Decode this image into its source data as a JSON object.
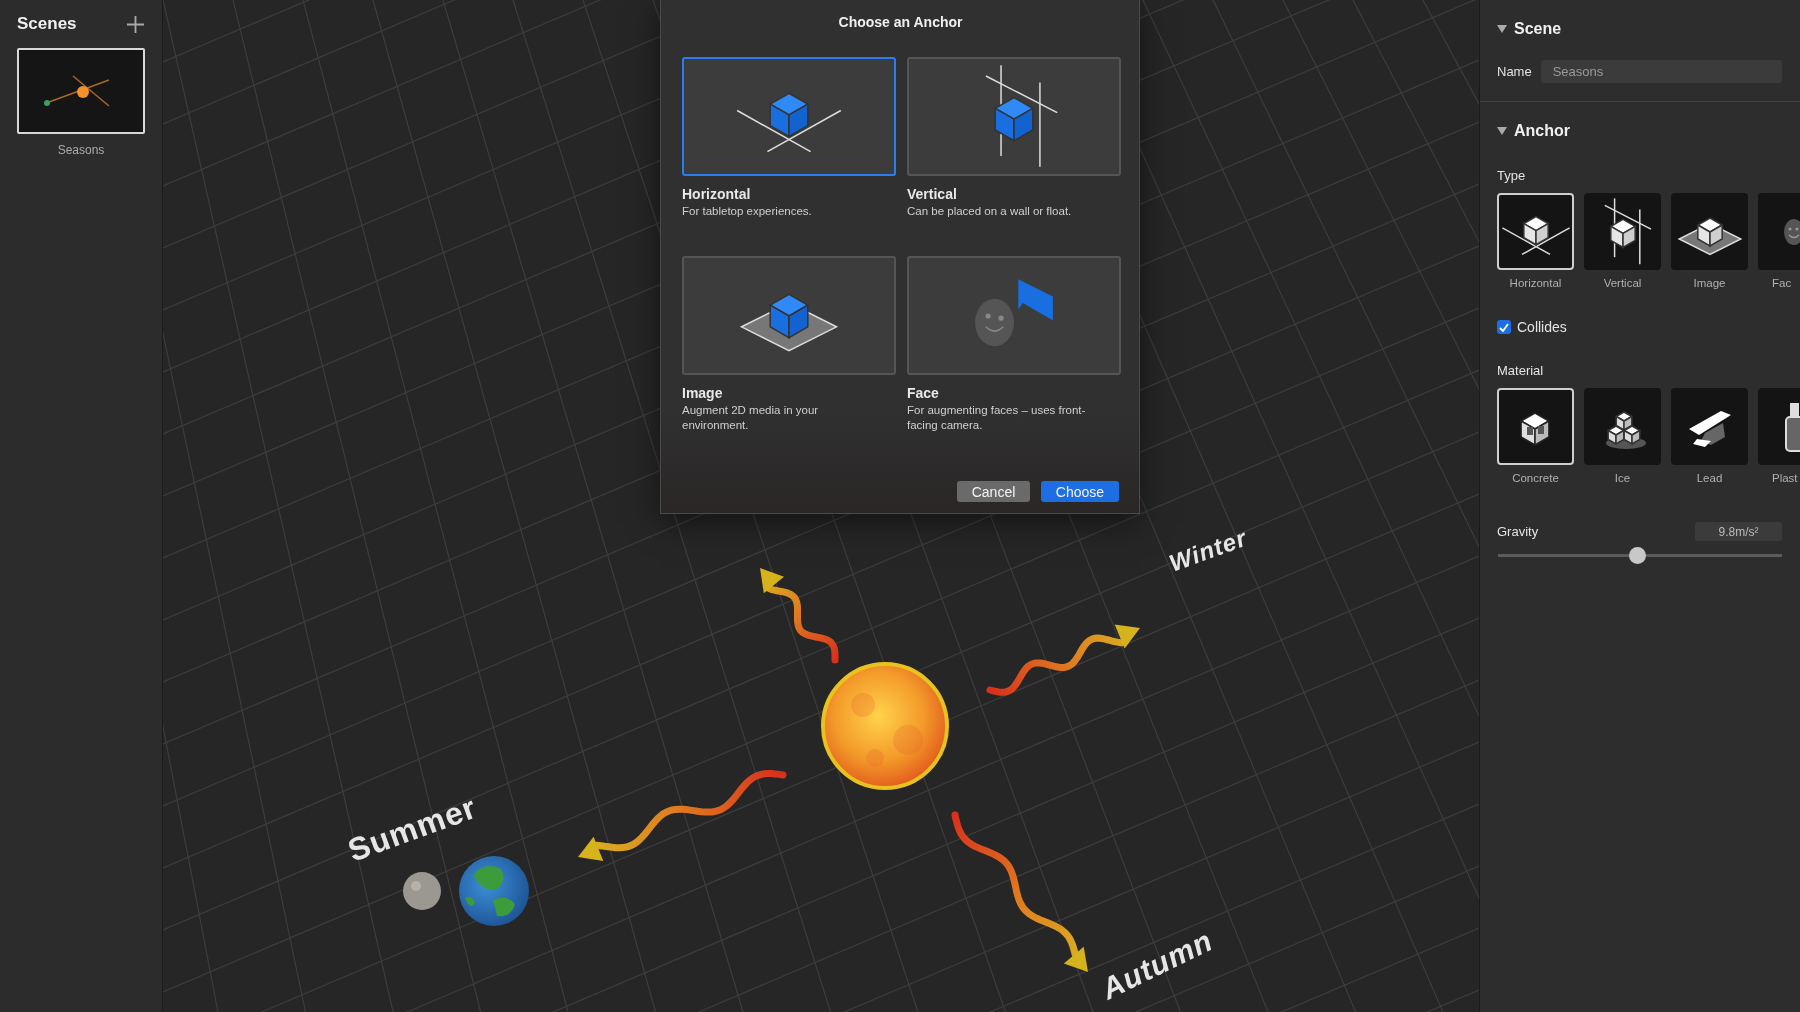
{
  "sidebar": {
    "title": "Scenes",
    "scenes": [
      {
        "name": "Seasons",
        "selected": true
      }
    ]
  },
  "viewport": {
    "labels": [
      "Summer",
      "Winter",
      "Autumn"
    ]
  },
  "dialog": {
    "title": "Choose an Anchor",
    "options": [
      {
        "title": "Horizontal",
        "description": "For tabletop experiences.",
        "selected": true
      },
      {
        "title": "Vertical",
        "description": "Can be placed on a wall or float.",
        "selected": false
      },
      {
        "title": "Image",
        "description": "Augment 2D media in your environment.",
        "selected": false
      },
      {
        "title": "Face",
        "description": "For augmenting faces – uses front-facing camera.",
        "selected": false
      }
    ],
    "buttons": [
      {
        "label": "Cancel",
        "kind": "secondary"
      },
      {
        "label": "Choose",
        "kind": "primary"
      }
    ]
  },
  "inspector": {
    "scene_section": {
      "title": "Scene",
      "expanded": true,
      "name_label": "Name",
      "name_value": "Seasons"
    },
    "anchor_section": {
      "title": "Anchor",
      "expanded": true,
      "type_label": "Type",
      "types": [
        {
          "label": "Horizontal",
          "selected": true
        },
        {
          "label": "Vertical",
          "selected": false
        },
        {
          "label": "Image",
          "selected": false
        },
        {
          "label": "Fac",
          "selected": false
        }
      ],
      "collides": {
        "label": "Collides",
        "checked": true
      },
      "material_label": "Material",
      "materials": [
        {
          "label": "Concrete",
          "selected": true
        },
        {
          "label": "Ice",
          "selected": false
        },
        {
          "label": "Lead",
          "selected": false
        },
        {
          "label": "Plast",
          "selected": false
        }
      ],
      "gravity": {
        "label": "Gravity",
        "value": "9.8m/s²",
        "level": 0.49
      }
    }
  }
}
